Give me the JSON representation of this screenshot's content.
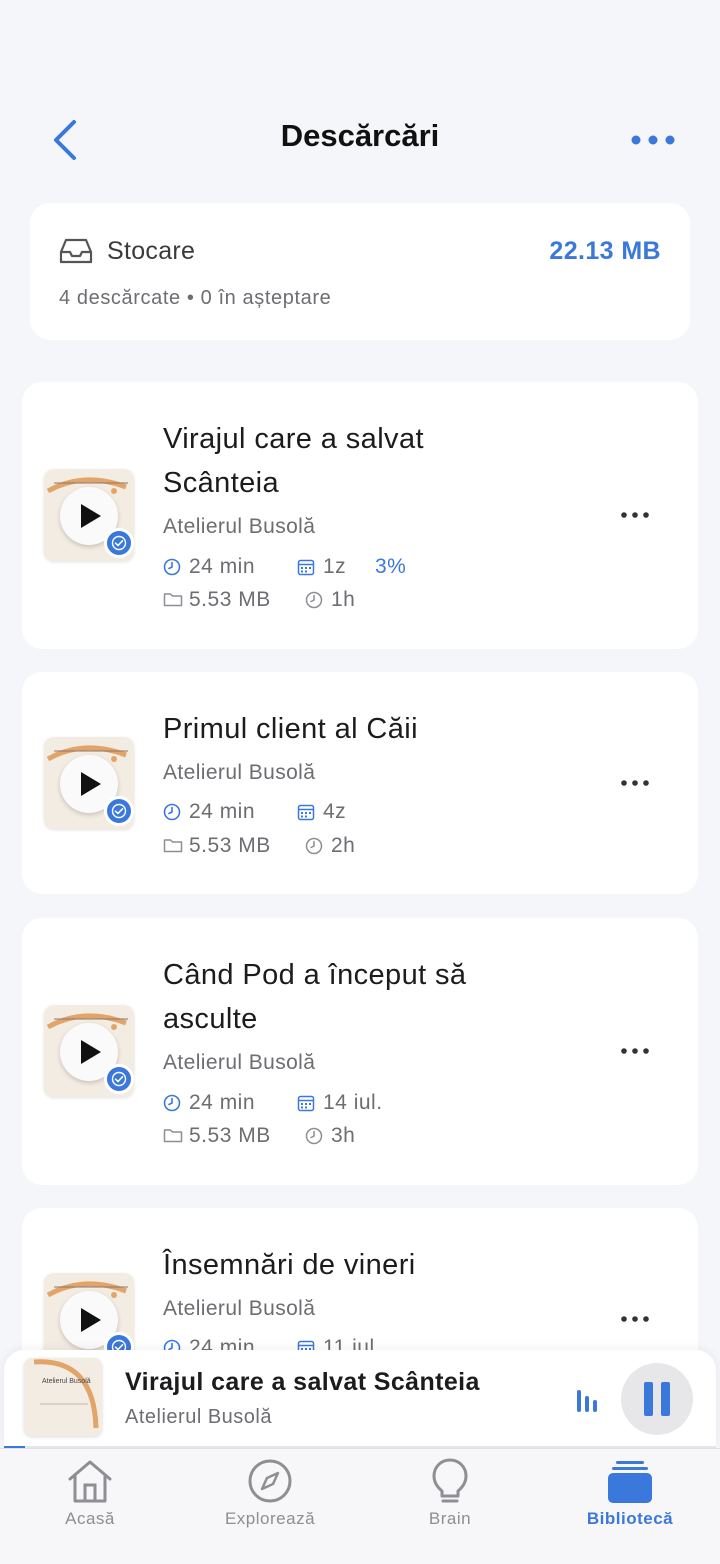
{
  "header": {
    "title": "Descărcări",
    "back_icon": "chevron-left-icon",
    "more_icon": "ellipsis-icon"
  },
  "storage": {
    "label": "Stocare",
    "size": "22.13 MB",
    "summary": "4 descărcate • 0 în așteptare",
    "icon": "tray-icon"
  },
  "episodes": [
    {
      "title": "Virajul care a salvat Scânteia",
      "author": "Atelierul Busolă",
      "duration": "24 min",
      "date": "1z",
      "progress": "3%",
      "size": "5.53 MB",
      "downloaded_ago": "1h"
    },
    {
      "title": "Primul client al Căii",
      "author": "Atelierul Busolă",
      "duration": "24 min",
      "date": "4z",
      "size": "5.53 MB",
      "downloaded_ago": "2h"
    },
    {
      "title": "Când Pod a început să asculte",
      "author": "Atelierul Busolă",
      "duration": "24 min",
      "date": "14 iul.",
      "size": "5.53 MB",
      "downloaded_ago": "3h"
    },
    {
      "title": "Însemnări de vineri",
      "author": "Atelierul Busolă",
      "duration": "24 min",
      "date": "11 iul."
    }
  ],
  "mini_player": {
    "title": "Virajul care a salvat Scânteia",
    "author": "Atelierul Busolă",
    "thumb_text": "Atelierul Busolă",
    "progress": 0.03
  },
  "tabs": [
    {
      "label": "Acasă",
      "icon": "home-icon"
    },
    {
      "label": "Explorează",
      "icon": "compass-icon"
    },
    {
      "label": "Brain",
      "icon": "lightbulb-icon"
    },
    {
      "label": "Bibliotecă",
      "icon": "library-icon",
      "active": true
    }
  ],
  "colors": {
    "accent": "#3b78dc",
    "background": "#f5f6f9",
    "card": "#ffffff",
    "thumb_bg": "#f3ece2",
    "thumb_arc": "#e3a46a"
  }
}
